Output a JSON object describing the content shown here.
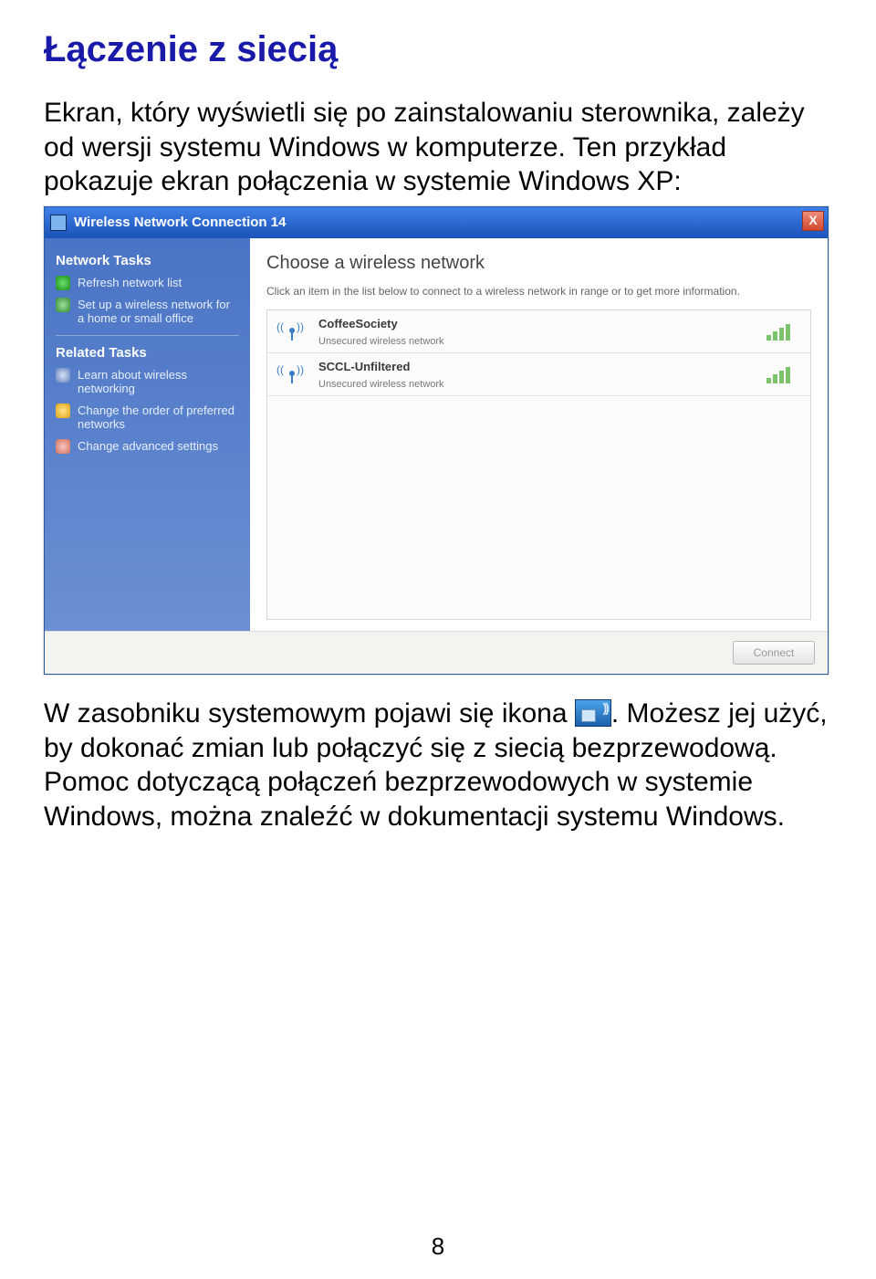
{
  "heading": "Łączenie z siecią",
  "para1": "Ekran, który wyświetli się po zainstalowaniu sterownika, zależy od wersji systemu Windows w komputerze. Ten przykład pokazuje ekran połączenia w systemie Windows XP:",
  "para2_before": "W zasobniku systemowym pojawi się ikona ",
  "para2_after": ". Możesz jej użyć, by dokonać zmian lub połączyć się z siecią bezprzewodową. Pomoc dotyczącą połączeń bezprzewodowych w systemie Windows, można znaleźć w dokumentacji systemu Windows.",
  "page_number": "8",
  "xp": {
    "title": "Wireless Network Connection 14",
    "close": "X",
    "sidebar": {
      "section1": "Network Tasks",
      "tasks1": [
        "Refresh network list",
        "Set up a wireless network for a home or small office"
      ],
      "section2": "Related Tasks",
      "tasks2": [
        "Learn about wireless networking",
        "Change the order of preferred networks",
        "Change advanced settings"
      ]
    },
    "main": {
      "heading": "Choose a wireless network",
      "sub": "Click an item in the list below to connect to a wireless network in range or to get more information.",
      "networks": [
        {
          "name": "CoffeeSociety",
          "status": "Unsecured wireless network"
        },
        {
          "name": "SCCL-Unfiltered",
          "status": "Unsecured wireless network"
        }
      ]
    },
    "connect_btn": "Connect"
  }
}
